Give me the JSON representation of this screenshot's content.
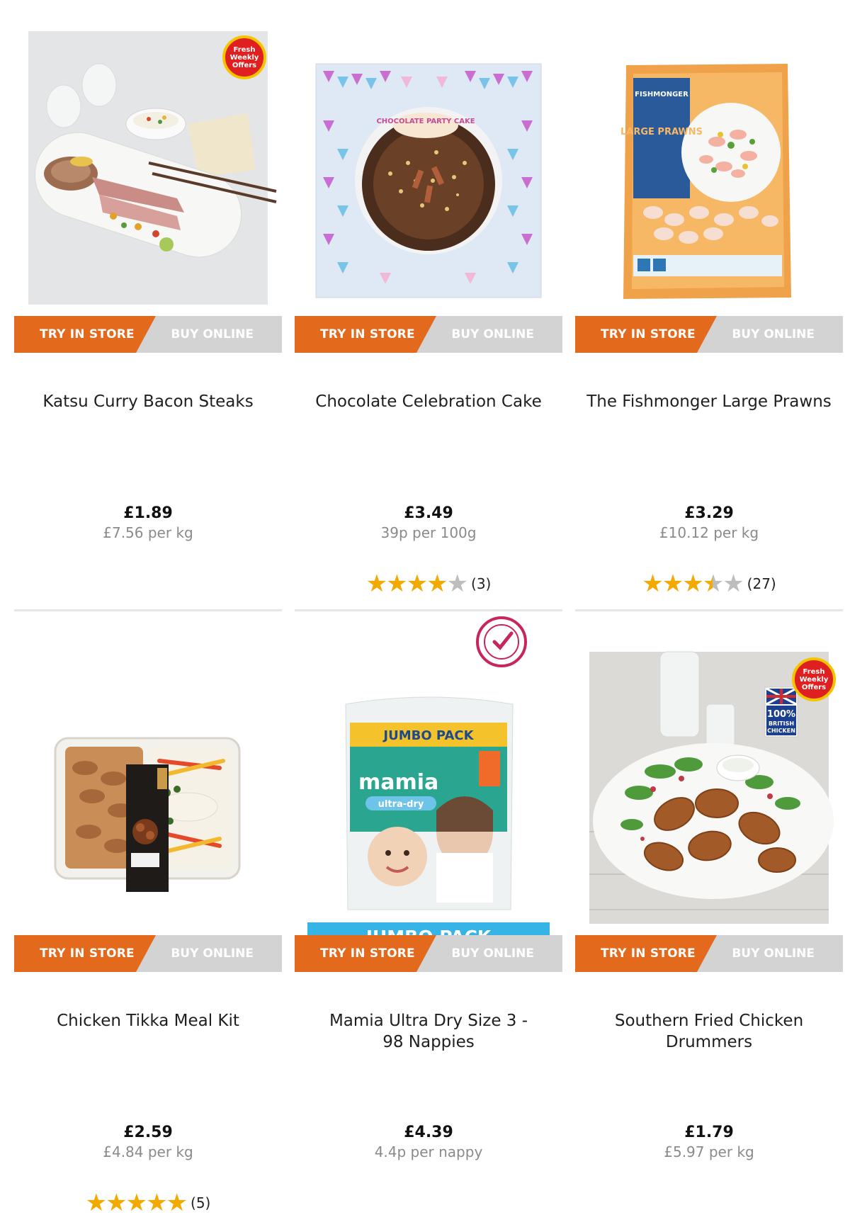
{
  "buttons": {
    "try_in_store": "TRY IN STORE",
    "buy_online": "BUY ONLINE"
  },
  "badges": {
    "fresh_weekly_line1": "Fresh",
    "fresh_weekly_line2": "Weekly",
    "fresh_weekly_line3": "Offers",
    "jumbo_pack": "JUMBO PACK",
    "british_chicken_line1": "100%",
    "british_chicken_line2": "BRITISH",
    "british_chicken_line3": "CHICKEN"
  },
  "colors": {
    "try_in_store_bg": "#e36a1c",
    "buy_online_bg": "#d3d3d3",
    "star_filled": "#f2a900",
    "star_empty": "#bdbdbd",
    "jumbo_banner": "#37b4e6"
  },
  "products": [
    {
      "name": "Katsu Curry Bacon Steaks",
      "price": "£1.89",
      "unit_price": "£7.56 per kg",
      "rating": null,
      "review_count": null,
      "image": "katsu-curry-bacon-steaks-photo",
      "badge": "fresh-weekly-offers"
    },
    {
      "name": "Chocolate Celebration Cake",
      "price": "£3.49",
      "unit_price": "39p per 100g",
      "rating": 4,
      "review_count": "(3)",
      "image": "chocolate-party-cake-box",
      "package_text": "CHOCOLATE PARTY CAKE"
    },
    {
      "name": "The Fishmonger Large Prawns",
      "price": "£3.29",
      "unit_price": "£10.12 per kg",
      "rating": 3.5,
      "review_count": "(27)",
      "image": "fishmonger-large-prawns-bag",
      "package_text": "FISHMONGER",
      "package_text2": "LARGE PRAWNS"
    },
    {
      "name": "Chicken Tikka Meal Kit",
      "price": "£2.59",
      "unit_price": "£4.84 per kg",
      "rating": 5,
      "review_count": "(5)",
      "image": "chicken-tikka-meal-kit-tray"
    },
    {
      "name": "Mamia Ultra Dry Size 3 - 98 Nappies",
      "price": "£4.39",
      "unit_price": "4.4p per nappy",
      "rating": null,
      "review_count": null,
      "image": "mamia-nappies-jumbo-pack",
      "package_text": "mamia",
      "package_text2": "ultra-dry",
      "badge": "jumbo-pack"
    },
    {
      "name": "Southern Fried Chicken Drummers",
      "price": "£1.79",
      "unit_price": "£5.97 per kg",
      "rating": null,
      "review_count": null,
      "image": "southern-fried-chicken-plate",
      "badge": "fresh-weekly-offers"
    }
  ]
}
